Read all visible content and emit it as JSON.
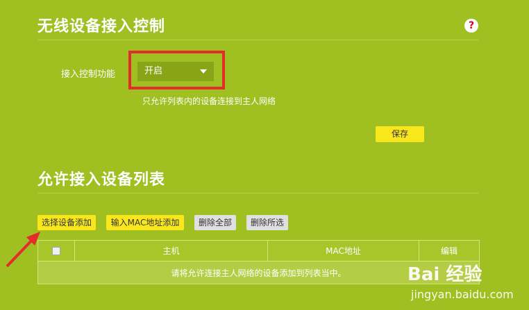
{
  "section1": {
    "title": "无线设备接入控制",
    "help_icon": "?",
    "access_label": "接入控制功能",
    "access_value": "开启",
    "hint": "只允许列表内的设备连接到主人网络",
    "save_label": "保存"
  },
  "section2": {
    "title": "允许接入设备列表",
    "buttons": {
      "select_add": "选择设备添加",
      "mac_add": "输入MAC地址添加",
      "delete_all": "删除全部",
      "delete_selected": "删除所选"
    },
    "table": {
      "headers": [
        "",
        "主机",
        "MAC地址",
        "编辑"
      ],
      "empty_message": "请将允许连接主人网络的设备添加到列表当中。"
    }
  },
  "watermark": {
    "brand": "Bai 经验",
    "url": "jingyan.baidu.com"
  },
  "colors": {
    "background": "#a0bf20",
    "highlight_border": "#e32d2d",
    "button_yellow": "#f8e71c",
    "arrow": "#e32d2d"
  }
}
